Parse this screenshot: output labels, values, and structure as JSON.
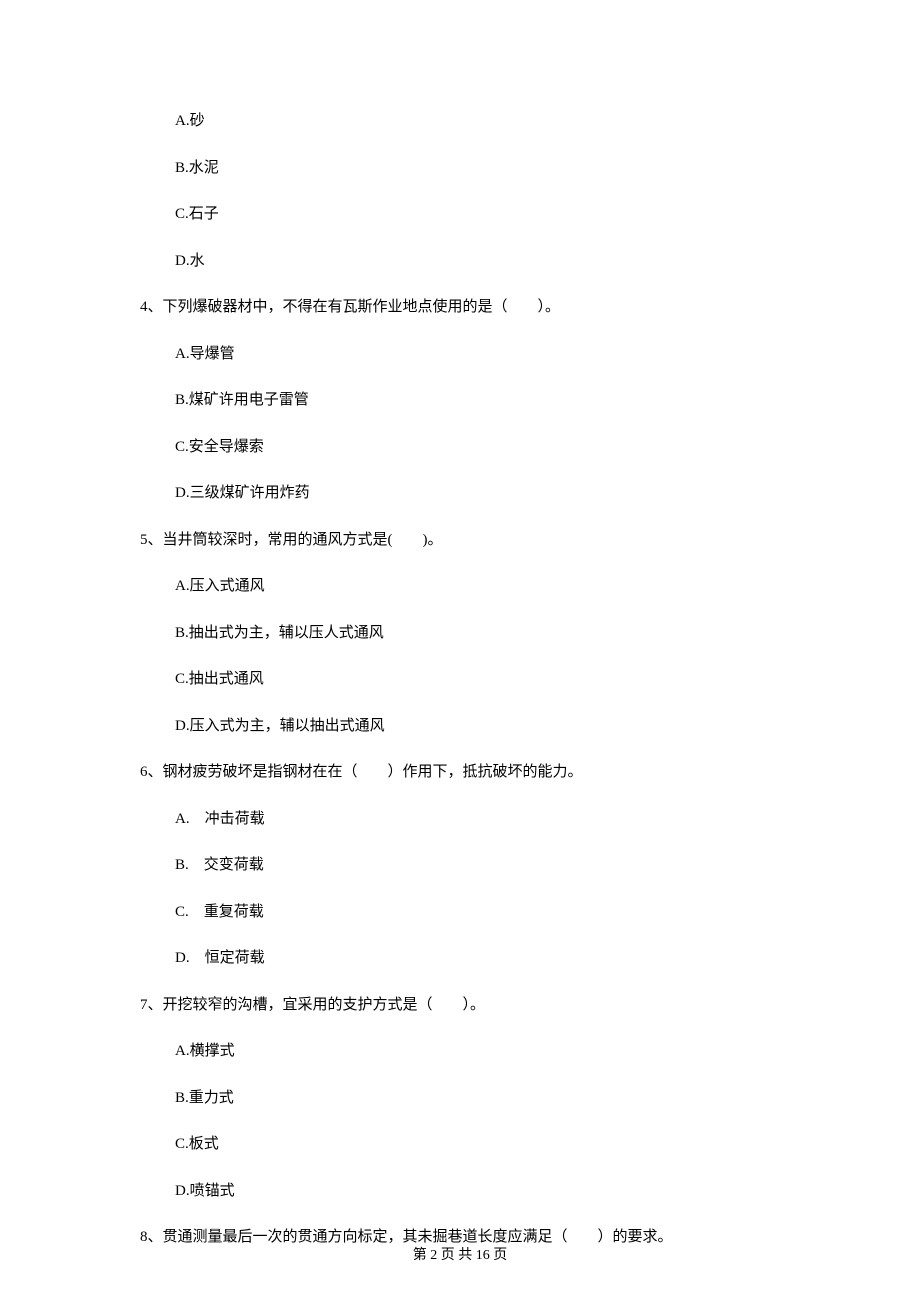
{
  "q3": {
    "options": {
      "A": "A.砂",
      "B": "B.水泥",
      "C": "C.石子",
      "D": "D.水"
    }
  },
  "q4": {
    "text": "4、下列爆破器材中，不得在有瓦斯作业地点使用的是（　　）。",
    "options": {
      "A": "A.导爆管",
      "B": "B.煤矿许用电子雷管",
      "C": "C.安全导爆索",
      "D": "D.三级煤矿许用炸药"
    }
  },
  "q5": {
    "text": "5、当井筒较深时，常用的通风方式是(　　)。",
    "options": {
      "A": "A.压入式通风",
      "B": "B.抽出式为主，辅以压人式通风",
      "C": "C.抽出式通风",
      "D": "D.压入式为主，辅以抽出式通风"
    }
  },
  "q6": {
    "text": "6、钢材疲劳破坏是指钢材在在（　　）作用下，抵抗破坏的能力。",
    "options": {
      "A": "A.　冲击荷载",
      "B": "B.　交变荷载",
      "C": "C.　重复荷载",
      "D": "D.　恒定荷载"
    }
  },
  "q7": {
    "text": "7、开挖较窄的沟槽，宜采用的支护方式是（　　）。",
    "options": {
      "A": "A.横撑式",
      "B": "B.重力式",
      "C": "C.板式",
      "D": "D.喷锚式"
    }
  },
  "q8": {
    "text": "8、贯通测量最后一次的贯通方向标定，其未掘巷道长度应满足（　　）的要求。"
  },
  "footer": "第 2 页 共 16 页"
}
